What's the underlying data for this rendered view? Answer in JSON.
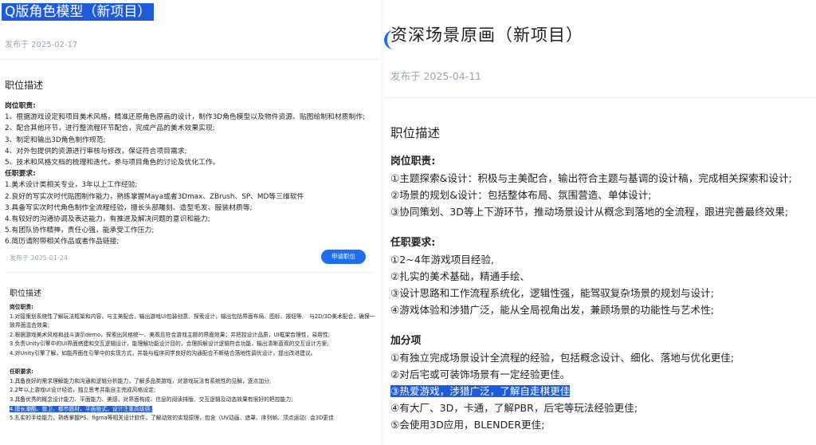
{
  "left": {
    "job1": {
      "title": "Q版角色模型（新项目）",
      "date": "发布于 2025-02-17",
      "section": "职位描述",
      "duties_heading": "岗位职责:",
      "duties": [
        "1、根据游戏设定和项目美术风格，精准还原角色原画的设计，制作3D角色模型以及物件资源、贴图绘制和材质制作;",
        "2、配合其他环节，进行整流程环节配合，完成产品的美术效果实现;",
        "3、制定和输出3D角色制作规范;",
        "4、对外包提供的资源进行审核与修改，保证符合项目需求;",
        "5、技术和风格文档的梳理和迭代，参与项目角色的讨论及优化工作。"
      ],
      "req_heading": "任职要求:",
      "requirements": [
        "1.美术设计类相关专业，3年以上工作经验;",
        "2.良好的写实次时代贴图制作能力，熟练掌握Maya或者3Dmax、ZBrush、SP、MD等三维软件",
        "3.具备写实次时代角色制作全流程经验，擅长头部雕刻、造型毛发、服装材质等;",
        "4.有较好的沟通协调及表达能力，有推进及解决问题的意识和能力;",
        "5.有团队协作精神，责任心强，能承受工作压力;",
        "6.简历请附带相关作品或者作品链接;"
      ]
    },
    "job2": {
      "date": "发布于 2025-01-24",
      "apply_label": "申请职位",
      "section": "职位描述",
      "duties_heading": "岗位职责:",
      "duties": [
        "1.对接策划系统性了解玩法框架和内容，与主美配合，输出游戏UI包装创意、探索设计，输出包括界面布局、图标、按钮等;　与2D/3D美术配合，确保一致界面混合效果;",
        "2.根据游戏美术风格和战斗演示demo，探索出风格统一、美观且符合游戏主题的界面效果；并把控设计品质，UI框架合理性，易用性;",
        "3.负责Unity引擎中的UI界面搭建和交互逻辑设计，能理解功能设计目的，合理拆解设计逻辑符合功能，输出清晰直观的交互设计方案;",
        "4.对Unity引擎了解，如能界面在引擎中的实现方式，并能与程序同学良好的沟通配合不断结合落地性调优设计，提出改进建议。"
      ],
      "req_heading": "任职要求:",
      "requirements": [
        "1.具备良好的需求理解能力和沟通和逻辑分析能力，了解多品类游戏，对游戏玩法有系统性的见解，逐点加分;",
        "2.2年以上游戏UI设计经验，独立思考并能自主完成风格设定;",
        "3.具备优秀的概念设计能力、平面能力、美感，对界面构成、信息的阅读排版、交互逻辑及动态效果有很好的把控能力;",
        "4.擅长潮酷、兽卫、都市题材，平面版式，设计注重高级感;",
        "5.扎实的手绘能力，熟练掌握PS、figma等相关设计软件，了解动效的实现原理，包含（UV动画、遮罩、序列帧、顶点运动）会3D更佳"
      ]
    }
  },
  "right": {
    "title": "资深场景原画（新项目）",
    "date": "发布于 2025-04-11",
    "section": "职位描述",
    "duties_heading": "岗位职责:",
    "duties": [
      "①主题探索&设计：积极与主美配合，输出符合主题与基调的设计稿，完成相关探索和设计;",
      "②场景的规划&设计：包括整体布局、氛围营造、单体设计;",
      "③协同策划、3D等上下游环节，推动场景设计从概念到落地的全流程，跟进完善最终效果;"
    ],
    "req_heading": "任职要求:",
    "requirements": [
      "①2~4年游戏项目经验,",
      "②扎实的美术基础，精通手绘、",
      "③设计思路和工作流程系统化，逻辑性强，能驾驭复杂场景的规划与设计;",
      "④游戏体验和涉猎广泛，能从全局视角出发，兼顾场景的功能性与艺术性;"
    ],
    "bonus_heading": "加分项",
    "bonus": [
      "①有独立完成场景设计全流程的经验，包括概念设计、细化、落地与优化更佳;",
      "②对后宅或可装饰场景有一定经验更佳。",
      "③热爱游戏，涉猎广泛，了解自走棋更佳",
      "④有大厂、3D，卡通，了解PBR，后宅等玩法经验更佳;",
      "⑤会使用3D应用，BLENDER更佳;"
    ]
  },
  "colors": {
    "selection_highlight": "#1e5bd8",
    "accent": "#1e6ef2",
    "muted_text": "#9aa3b2"
  }
}
